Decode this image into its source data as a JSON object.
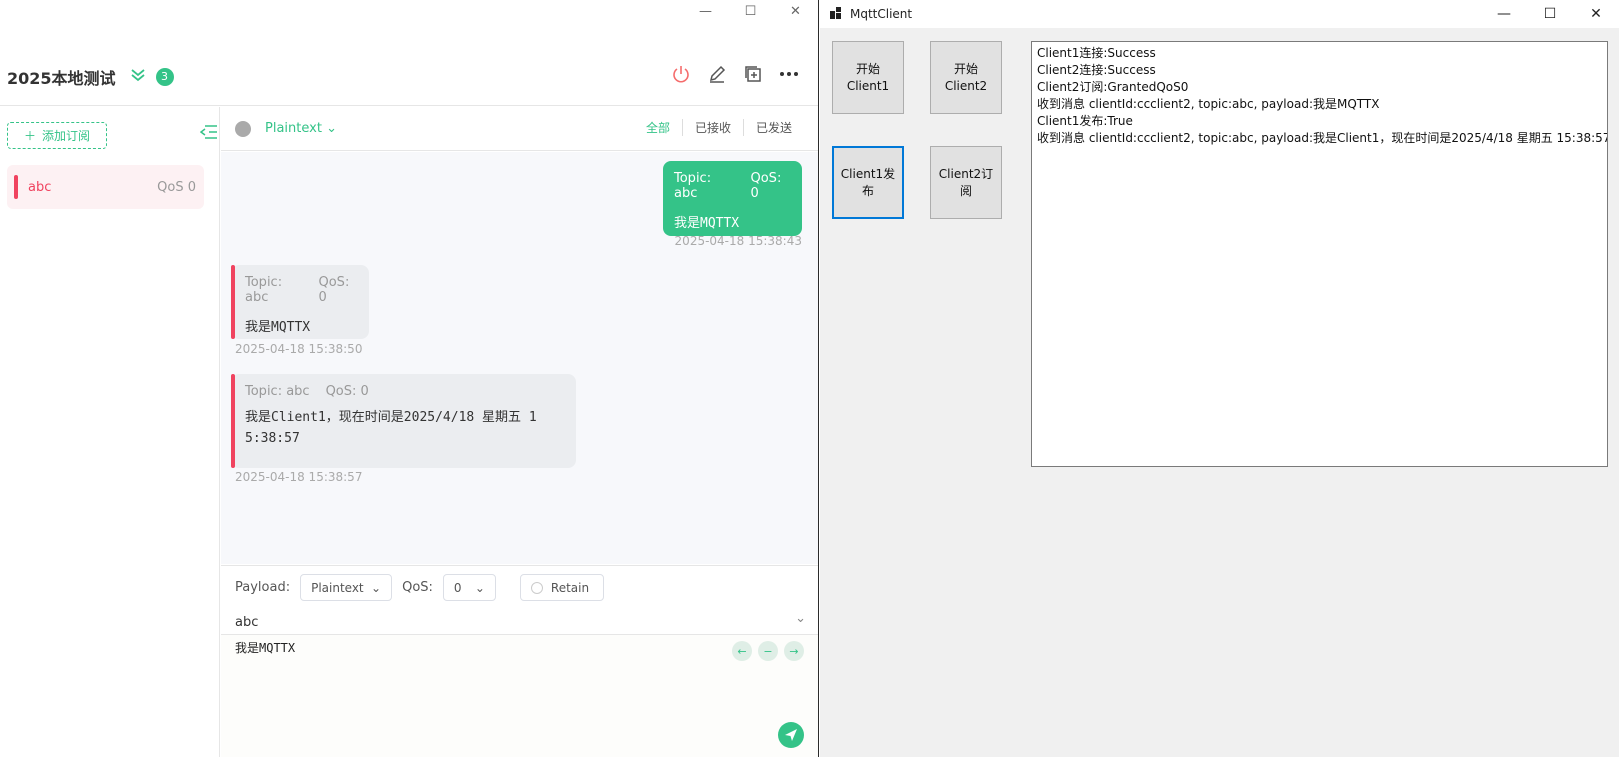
{
  "mqttx": {
    "window_controls": [
      "—",
      "☐",
      "✕"
    ],
    "connection": {
      "name": "2025本地测试",
      "badge_count": "3"
    },
    "sidebar": {
      "add_subscription": "添加订阅",
      "subscriptions": [
        {
          "topic": "abc",
          "qos": "QoS 0",
          "color": "#f0435f"
        }
      ]
    },
    "topbar": {
      "format": "Plaintext",
      "filters": [
        "全部",
        "已接收",
        "已发送"
      ]
    },
    "messages": [
      {
        "direction": "out",
        "topic": "Topic: abc",
        "qos": "QoS: 0",
        "payload": "我是MQTTX",
        "time": "2025-04-18 15:38:43"
      },
      {
        "direction": "in",
        "topic": "Topic: abc",
        "qos": "QoS: 0",
        "payload": "我是MQTTX",
        "time": "2025-04-18 15:38:50"
      },
      {
        "direction": "in",
        "topic": "Topic: abc",
        "qos": "QoS: 0",
        "payload_line1": "我是Client1，现在时间是2025/4/18 星期五 1",
        "payload_line2": "5:38:57",
        "time": "2025-04-18 15:38:57"
      }
    ],
    "compose": {
      "payload_label": "Payload:",
      "payload_format": "Plaintext",
      "qos_label": "QoS:",
      "qos_value": "0",
      "retain_label": "Retain",
      "topic": "abc",
      "payload": "我是MQTTX"
    },
    "accent": "#34c388"
  },
  "winform": {
    "title": "MqttClient",
    "window_controls": [
      "—",
      "☐",
      "✕"
    ],
    "buttons": {
      "start_client1": "开始\nClient1",
      "start_client2": "开始\nClient2",
      "client1_publish": "Client1发\n布",
      "client2_subscribe": "Client2订\n阅"
    },
    "log_lines": [
      "Client1连接:Success",
      "Client2连接:Success",
      "Client2订阅:GrantedQoS0",
      "收到消息 clientId:ccclient2, topic:abc, payload:我是MQTTX",
      "Client1发布:True",
      "收到消息 clientId:ccclient2, topic:abc, payload:我是Client1，现在时间是2025/4/18 星期五 15:38:57"
    ]
  }
}
